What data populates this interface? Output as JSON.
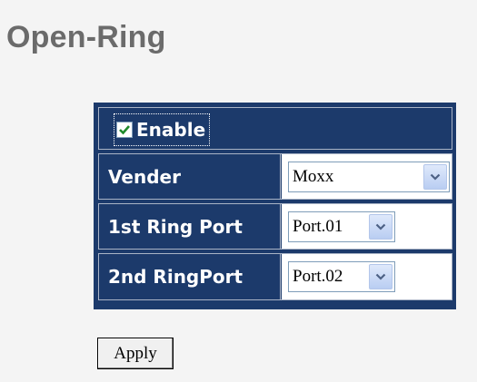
{
  "page": {
    "title": "Open-Ring"
  },
  "form": {
    "enable": {
      "label": "Enable",
      "checked": true
    },
    "vender": {
      "label": "Vender",
      "value": "Moxx"
    },
    "ring_port_1": {
      "label": "1st Ring Port",
      "value": "Port.01"
    },
    "ring_port_2": {
      "label": "2nd RingPort",
      "value": "Port.02"
    },
    "apply_label": "Apply"
  },
  "colors": {
    "table_bg": "#1c3a6b",
    "title": "#6b6b6b",
    "check": "#1f8a2b"
  },
  "icons": {
    "checkbox": "check-icon",
    "dropdown": "chevron-down-icon"
  }
}
